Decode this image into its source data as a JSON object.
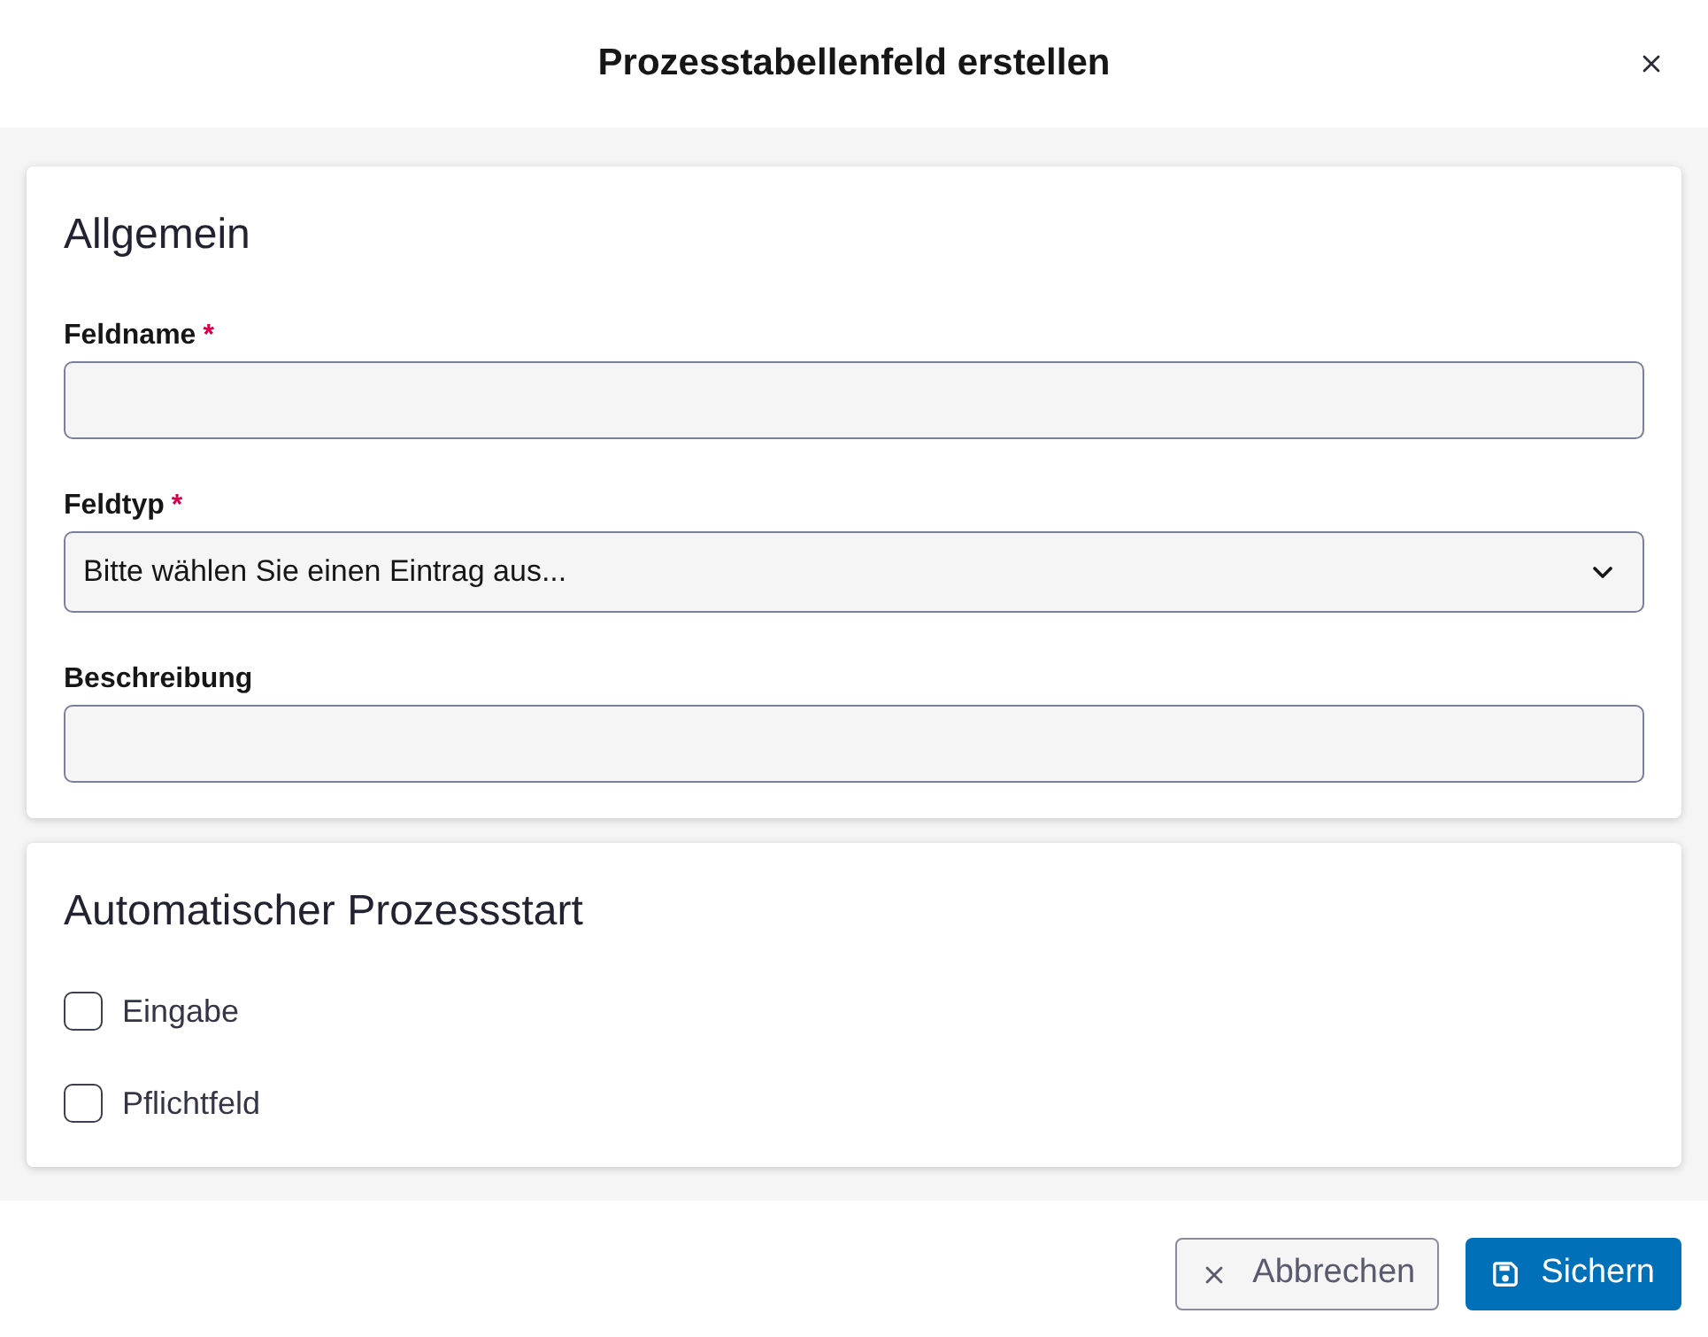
{
  "dialog": {
    "title": "Prozesstabellenfeld erstellen"
  },
  "sections": [
    {
      "title": "Allgemein",
      "fields": [
        {
          "kind": "text",
          "label": "Feldname",
          "required_mark": "*"
        },
        {
          "kind": "select",
          "label": "Feldtyp",
          "required_mark": "*",
          "placeholder": "Bitte wählen Sie einen Eintrag aus..."
        },
        {
          "kind": "text",
          "label": "Beschreibung"
        }
      ]
    },
    {
      "title": "Automatischer Prozessstart",
      "fields": [
        {
          "kind": "checkbox",
          "label": "Eingabe",
          "checked": false
        },
        {
          "kind": "checkbox",
          "label": "Pflichtfeld",
          "checked": false
        }
      ]
    }
  ],
  "buttons": [
    {
      "kind": "secondary",
      "label": "Abbrechen"
    },
    {
      "kind": "primary",
      "label": "Sichern"
    }
  ]
}
